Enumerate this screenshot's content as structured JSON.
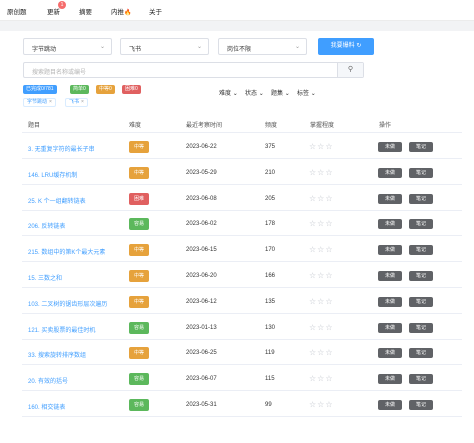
{
  "nav": {
    "items": [
      {
        "label": "原创题"
      },
      {
        "label": "更新",
        "badge": "1"
      },
      {
        "label": "摘要"
      },
      {
        "label": "内推",
        "icon": "fire-icon"
      },
      {
        "label": "关于"
      }
    ]
  },
  "filters": {
    "company": "字节跳动",
    "department": "飞书",
    "position": "岗位不限",
    "submit_label": "我要爆料"
  },
  "search": {
    "placeholder": "搜索题目名称或编号"
  },
  "stats_tags": {
    "done": "已完成0/781",
    "easy": "简单0",
    "medium": "中等0",
    "hard": "困难0"
  },
  "active_tags": [
    "字节跳动",
    "飞书"
  ],
  "column_filters": [
    "难度",
    "状态",
    "题集",
    "标签"
  ],
  "table": {
    "headers": {
      "title": "题目",
      "difficulty": "难度",
      "last_seen": "最近考察时间",
      "frequency": "频度",
      "mastery": "掌握程度",
      "ops": "操作"
    },
    "rows": [
      {
        "title": "3. 无重复字符的最长子串",
        "difficulty": "中等",
        "date": "2023-06-22",
        "freq": "375"
      },
      {
        "title": "146. LRU缓存机制",
        "difficulty": "中等",
        "date": "2023-05-29",
        "freq": "210"
      },
      {
        "title": "25. K 个一组翻转链表",
        "difficulty": "困难",
        "date": "2023-06-08",
        "freq": "205"
      },
      {
        "title": "206. 反转链表",
        "difficulty": "容易",
        "date": "2023-06-02",
        "freq": "178"
      },
      {
        "title": "215. 数组中的第K个最大元素",
        "difficulty": "中等",
        "date": "2023-06-15",
        "freq": "170"
      },
      {
        "title": "15. 三数之和",
        "difficulty": "中等",
        "date": "2023-06-20",
        "freq": "166"
      },
      {
        "title": "103. 二叉树的锯齿形层次遍历",
        "difficulty": "中等",
        "date": "2023-06-12",
        "freq": "135"
      },
      {
        "title": "121. 买卖股票的最佳时机",
        "difficulty": "容易",
        "date": "2023-01-13",
        "freq": "130"
      },
      {
        "title": "33. 搜索旋转排序数组",
        "difficulty": "中等",
        "date": "2023-06-25",
        "freq": "119"
      },
      {
        "title": "20. 有效的括号",
        "difficulty": "容易",
        "date": "2023-06-07",
        "freq": "115"
      },
      {
        "title": "160. 相交链表",
        "difficulty": "容易",
        "date": "2023-05-31",
        "freq": "99"
      }
    ],
    "op_labels": {
      "done": "未做",
      "note": "笔记"
    }
  },
  "colors": {
    "primary": "#409eff",
    "medium": "#e6a23c",
    "hard": "#e06060",
    "easy": "#5cb85c",
    "op": "#606266"
  }
}
